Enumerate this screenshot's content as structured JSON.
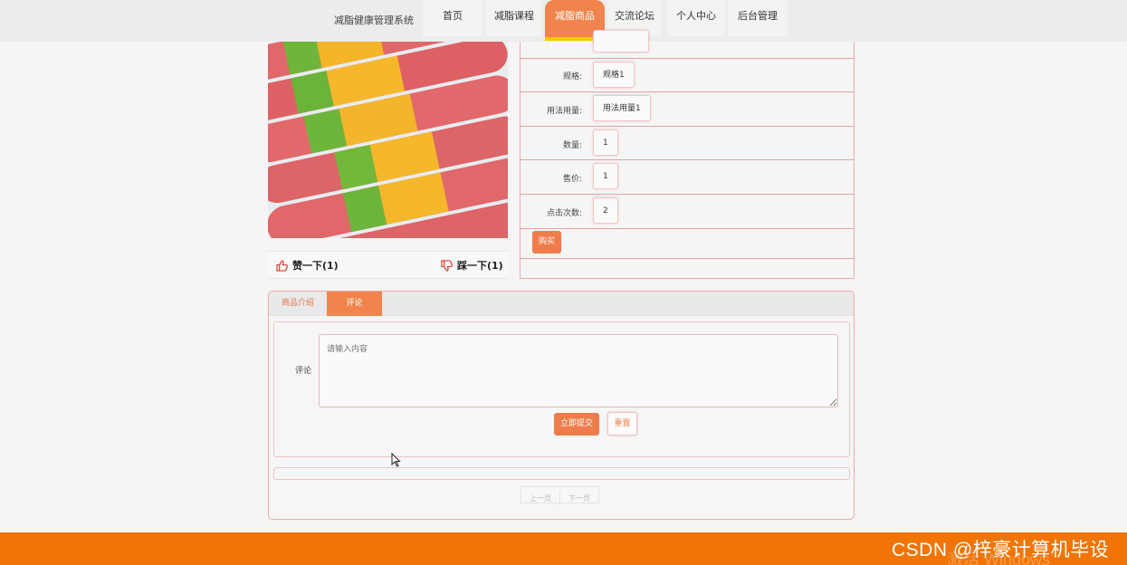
{
  "nav": {
    "brand": "减脂健康管理系统",
    "items": [
      {
        "label": "首页"
      },
      {
        "label": "减脂课程"
      },
      {
        "label": "减脂商品"
      },
      {
        "label": "交流论坛"
      },
      {
        "label": "个人中心"
      },
      {
        "label": "后台管理"
      }
    ],
    "active_index": 2
  },
  "votes": {
    "like": "赞一下(1)",
    "dislike": "踩一下(1)"
  },
  "details": [
    {
      "label": "规格:",
      "value": "规格1"
    },
    {
      "label": "用法用量:",
      "value": "用法用量1"
    },
    {
      "label": "数量:",
      "value": "1"
    },
    {
      "label": "售价:",
      "value": "1"
    },
    {
      "label": "点击次数:",
      "value": "2"
    }
  ],
  "buy_label": "购买",
  "tabs": [
    {
      "label": "商品介绍"
    },
    {
      "label": "评论"
    }
  ],
  "comment": {
    "label": "评论",
    "placeholder": "请输入内容",
    "submit": "立即提交",
    "reset": "重置"
  },
  "pager": {
    "prev": "上一页",
    "next": "下一页"
  },
  "watermark": {
    "csdn": "CSDN @梓豪计算机毕设",
    "windows": "激活 Windows"
  },
  "colors": {
    "accent": "#f0844c",
    "footer": "#f27405",
    "tab_underline": "#f2c900"
  }
}
